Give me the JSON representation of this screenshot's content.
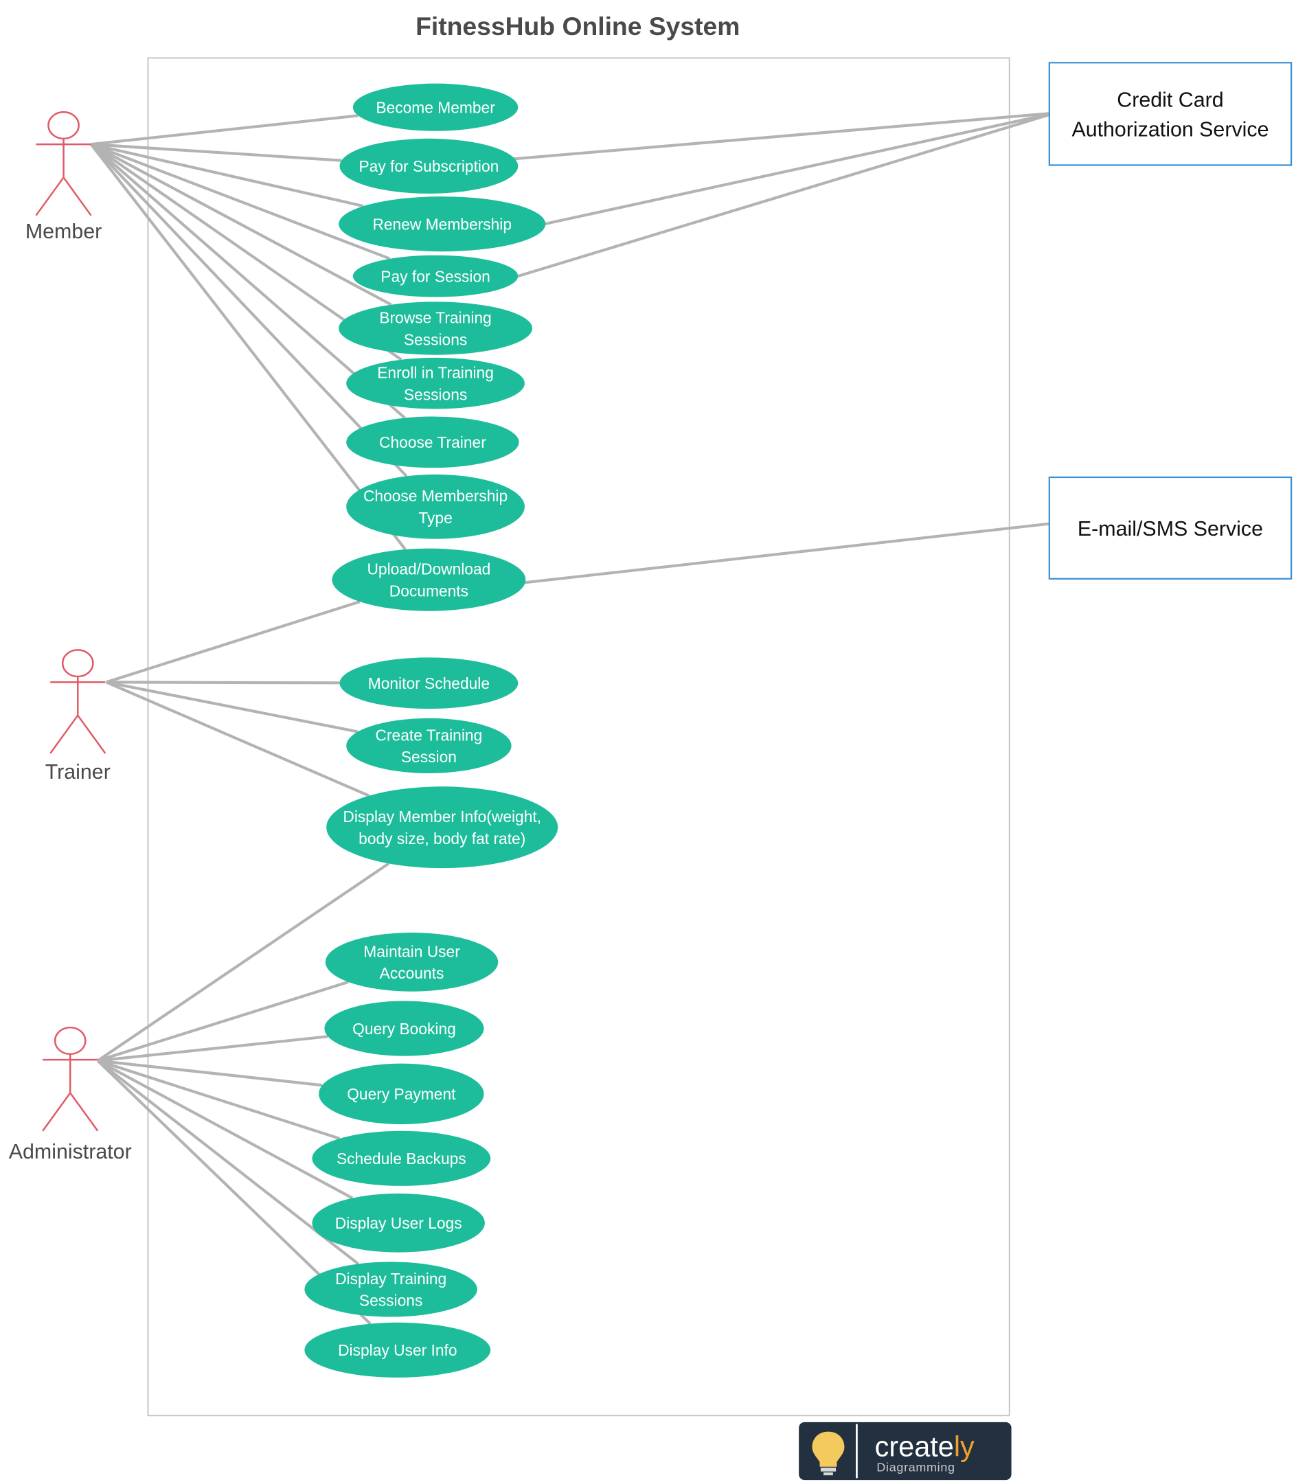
{
  "title": "FitnessHub Online System",
  "colors": {
    "usecase_fill": "#1dbd9b",
    "actor_stroke": "#e05a66",
    "association_line": "#b3b3b3",
    "external_box_border": "#3a8fd6",
    "boundary_border": "#c8c8c8"
  },
  "actors": [
    {
      "id": "member",
      "label": "Member"
    },
    {
      "id": "trainer",
      "label": "Trainer"
    },
    {
      "id": "administrator",
      "label": "Administrator"
    }
  ],
  "external_systems": [
    {
      "id": "credit_card",
      "lines": [
        "Credit Card",
        "Authorization Service"
      ]
    },
    {
      "id": "email_sms",
      "lines": [
        "E-mail/SMS Service"
      ]
    }
  ],
  "use_cases": [
    {
      "id": "become_member",
      "lines": [
        "Become Member"
      ]
    },
    {
      "id": "pay_subscription",
      "lines": [
        "Pay for Subscription"
      ]
    },
    {
      "id": "renew_membership",
      "lines": [
        "Renew Membership"
      ]
    },
    {
      "id": "pay_session",
      "lines": [
        "Pay for Session"
      ]
    },
    {
      "id": "browse_training",
      "lines": [
        "Browse Training",
        "Sessions"
      ]
    },
    {
      "id": "enroll_training",
      "lines": [
        "Enroll in Training",
        "Sessions"
      ]
    },
    {
      "id": "choose_trainer",
      "lines": [
        "Choose Trainer"
      ]
    },
    {
      "id": "choose_membership_type",
      "lines": [
        "Choose Membership",
        "Type"
      ]
    },
    {
      "id": "upload_download",
      "lines": [
        "Upload/Download",
        "Documents"
      ]
    },
    {
      "id": "monitor_schedule",
      "lines": [
        "Monitor Schedule"
      ]
    },
    {
      "id": "create_training",
      "lines": [
        "Create Training",
        "Session"
      ]
    },
    {
      "id": "display_member_info",
      "lines": [
        "Display Member Info(weight,",
        "body size, body fat rate)"
      ]
    },
    {
      "id": "maintain_accounts",
      "lines": [
        "Maintain User",
        "Accounts"
      ]
    },
    {
      "id": "query_booking",
      "lines": [
        "Query Booking"
      ]
    },
    {
      "id": "query_payment",
      "lines": [
        "Query Payment"
      ]
    },
    {
      "id": "schedule_backups",
      "lines": [
        "Schedule Backups"
      ]
    },
    {
      "id": "display_user_logs",
      "lines": [
        "Display User Logs"
      ]
    },
    {
      "id": "display_training",
      "lines": [
        "Display Training",
        "Sessions"
      ]
    },
    {
      "id": "display_user_info",
      "lines": [
        "Display User Info"
      ]
    }
  ],
  "associations": [
    [
      "member",
      "become_member"
    ],
    [
      "member",
      "pay_subscription"
    ],
    [
      "member",
      "renew_membership"
    ],
    [
      "member",
      "pay_session"
    ],
    [
      "member",
      "browse_training"
    ],
    [
      "member",
      "enroll_training"
    ],
    [
      "member",
      "choose_trainer"
    ],
    [
      "member",
      "choose_membership_type"
    ],
    [
      "member",
      "upload_download"
    ],
    [
      "trainer",
      "upload_download"
    ],
    [
      "trainer",
      "monitor_schedule"
    ],
    [
      "trainer",
      "create_training"
    ],
    [
      "trainer",
      "display_member_info"
    ],
    [
      "administrator",
      "display_member_info"
    ],
    [
      "administrator",
      "maintain_accounts"
    ],
    [
      "administrator",
      "query_booking"
    ],
    [
      "administrator",
      "query_payment"
    ],
    [
      "administrator",
      "schedule_backups"
    ],
    [
      "administrator",
      "display_user_logs"
    ],
    [
      "administrator",
      "display_training"
    ],
    [
      "administrator",
      "display_user_info"
    ],
    [
      "pay_subscription",
      "credit_card"
    ],
    [
      "renew_membership",
      "credit_card"
    ],
    [
      "pay_session",
      "credit_card"
    ],
    [
      "upload_download",
      "email_sms"
    ]
  ],
  "logo": {
    "brand_main": "create",
    "brand_accent": "ly",
    "subtitle": "Diagramming",
    "icon": "lightbulb-icon"
  }
}
